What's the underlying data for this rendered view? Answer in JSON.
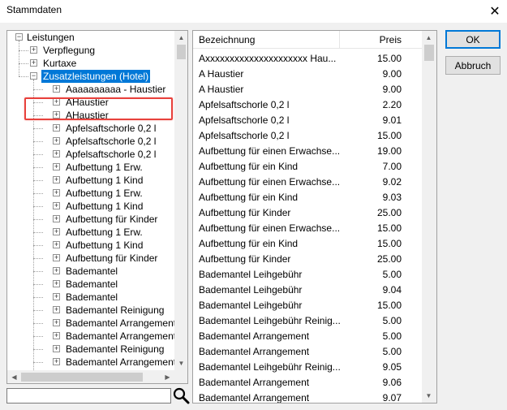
{
  "window": {
    "title": "Stammdaten",
    "close_glyph": "✕"
  },
  "tree": {
    "root_label": "Leistungen",
    "children": [
      "Verpflegung",
      "Kurtaxe",
      "Zusatzleistungen (Hotel)"
    ],
    "selected_label": "Zusatzleistungen (Hotel)",
    "sub_items": [
      "Aaaaaaaaaa - Haustier",
      "AHaustier",
      "AHaustier",
      "Apfelsaftschorle 0,2 l",
      "Apfelsaftschorle 0,2 l",
      "Apfelsaftschorle 0,2 l",
      "Aufbettung 1 Erw.",
      "Aufbettung 1 Kind",
      "Aufbettung 1 Erw.",
      "Aufbettung 1 Kind",
      "Aufbettung für Kinder",
      "Aufbettung 1 Erw.",
      "Aufbettung 1 Kind",
      "Aufbettung für Kinder",
      "Bademantel",
      "Bademantel",
      "Bademantel",
      "Bademantel Reinigung",
      "Bademantel Arrangement",
      "Bademantel Arrangement",
      "Bademantel Reinigung",
      "Bademantel Arrangement"
    ]
  },
  "list": {
    "col_name": "Bezeichnung",
    "col_price": "Preis",
    "rows": [
      {
        "name": "Axxxxxxxxxxxxxxxxxxxxx Hau...",
        "price": "15.00"
      },
      {
        "name": "A Haustier",
        "price": "9.00"
      },
      {
        "name": "A Haustier",
        "price": "9.00"
      },
      {
        "name": "Apfelsaftschorle 0,2 l",
        "price": "2.20"
      },
      {
        "name": "Apfelsaftschorle 0,2 l",
        "price": "9.01"
      },
      {
        "name": "Apfelsaftschorle 0,2 l",
        "price": "15.00"
      },
      {
        "name": "Aufbettung für einen Erwachse...",
        "price": "19.00"
      },
      {
        "name": "Aufbettung für ein Kind",
        "price": "7.00"
      },
      {
        "name": "Aufbettung für einen Erwachse...",
        "price": "9.02"
      },
      {
        "name": "Aufbettung für ein Kind",
        "price": "9.03"
      },
      {
        "name": "Aufbettung für Kinder",
        "price": "25.00"
      },
      {
        "name": "Aufbettung für einen Erwachse...",
        "price": "15.00"
      },
      {
        "name": "Aufbettung für ein Kind",
        "price": "15.00"
      },
      {
        "name": "Aufbettung für Kinder",
        "price": "25.00"
      },
      {
        "name": "Bademantel Leihgebühr",
        "price": "5.00"
      },
      {
        "name": "Bademantel Leihgebühr",
        "price": "9.04"
      },
      {
        "name": "Bademantel Leihgebühr",
        "price": "15.00"
      },
      {
        "name": "Bademantel Leihgebühr Reinig...",
        "price": "5.00"
      },
      {
        "name": "Bademantel Arrangement",
        "price": "5.00"
      },
      {
        "name": "Bademantel Arrangement",
        "price": "5.00"
      },
      {
        "name": "Bademantel Leihgebühr Reinig...",
        "price": "9.05"
      },
      {
        "name": "Bademantel Arrangement",
        "price": "9.06"
      },
      {
        "name": "Bademantel Arrangement",
        "price": "9.07"
      }
    ]
  },
  "buttons": {
    "ok": "OK",
    "cancel": "Abbruch"
  },
  "search": {
    "value": ""
  },
  "icons": {
    "expand": "+",
    "collapse": "−"
  },
  "colors": {
    "selection": "#0078d7",
    "highlight_box": "#e8413c"
  }
}
